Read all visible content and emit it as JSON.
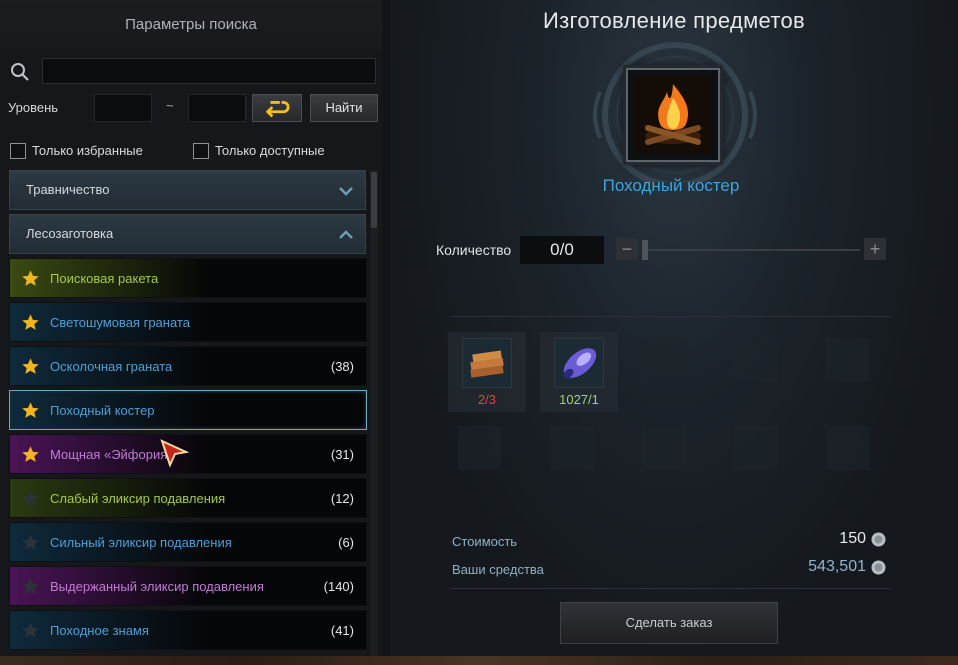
{
  "left_panel": {
    "title": "Параметры поиска",
    "search": {
      "placeholder": "",
      "value": ""
    },
    "level": {
      "label": "Уровень",
      "separator": "~",
      "min": "",
      "max": ""
    },
    "find_label": "Найти",
    "filters": [
      {
        "label": "Только избранные",
        "checked": false
      },
      {
        "label": "Только доступные",
        "checked": false
      }
    ],
    "categories": [
      {
        "label": "Травничество",
        "expanded": false
      },
      {
        "label": "Лесозаготовка",
        "expanded": true
      }
    ],
    "items": [
      {
        "name": "Поисковая ракета",
        "count": "",
        "favorite": true,
        "color": "#a6c94a",
        "glow": "#3a4a12"
      },
      {
        "name": "Светошумовая граната",
        "count": "",
        "favorite": true,
        "color": "#4f9fd6",
        "glow": "#0f2a3c"
      },
      {
        "name": "Осколочная граната",
        "count": "(38)",
        "favorite": true,
        "color": "#4f9fd6",
        "glow": "#0f2a3c"
      },
      {
        "name": "Походный костер",
        "count": "",
        "favorite": true,
        "color": "#4f9fd6",
        "glow": "#0f2a3c",
        "selected": true
      },
      {
        "name": "Мощная «Эйфория»",
        "count": "(31)",
        "favorite": true,
        "color": "#c27ad6",
        "glow": "#4a1456"
      },
      {
        "name": "Слабый эликсир подавления",
        "count": "(12)",
        "favorite": false,
        "color": "#a6c94a",
        "glow": "#2a3a10"
      },
      {
        "name": "Сильный эликсир подавления",
        "count": "(6)",
        "favorite": false,
        "color": "#4f9fd6",
        "glow": "#0f2a3c"
      },
      {
        "name": "Выдержанный эликсир подавления",
        "count": "(140)",
        "favorite": false,
        "color": "#c27ad6",
        "glow": "#4a1456"
      },
      {
        "name": "Походное знамя",
        "count": "(41)",
        "favorite": false,
        "color": "#4f9fd6",
        "glow": "#0f2a3c"
      }
    ]
  },
  "craft": {
    "title": "Изготовление предметов",
    "item_name": "Походный костер",
    "quantity": {
      "label": "Количество",
      "value": "0/0",
      "minus": "−",
      "plus": "+"
    },
    "materials": [
      {
        "icon": "timber-icon",
        "count": "2/3",
        "count_color": "#e0453a"
      },
      {
        "icon": "crystal-log-icon",
        "count": "1027/1",
        "count_color": "#9fd46a"
      }
    ],
    "cost": {
      "label": "Стоимость",
      "value": "150"
    },
    "funds": {
      "label": "Ваши средства",
      "value": "543,501"
    },
    "order_label": "Сделать заказ"
  }
}
